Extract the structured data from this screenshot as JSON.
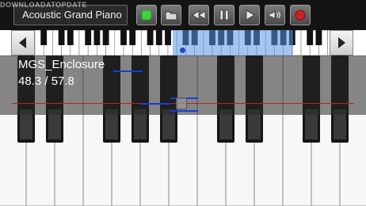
{
  "toolbar": {
    "instrument": "Acoustic Grand Piano",
    "watermark": "DOWNLOADATOPDATE",
    "buttons": [
      {
        "name": "play-green-button",
        "icon": "green-dot-icon"
      },
      {
        "name": "open-folder-button",
        "icon": "folder-icon"
      },
      {
        "name": "rewind-button",
        "icon": "rewind-icon"
      },
      {
        "name": "pause-button",
        "icon": "pause-icon"
      },
      {
        "name": "play-button",
        "icon": "play-icon"
      },
      {
        "name": "volume-button",
        "icon": "speaker-icon"
      },
      {
        "name": "record-button",
        "icon": "record-icon"
      }
    ]
  },
  "song": {
    "track_name": "MGS_Enclosure",
    "position": "48.3 / 57.8"
  },
  "colors": {
    "accent_green": "#3fd23f",
    "record_red": "#cc2222",
    "selection_blue": "#5a96e6",
    "note_blue": "#1a3cd6",
    "playhead_red": "#c02020"
  }
}
